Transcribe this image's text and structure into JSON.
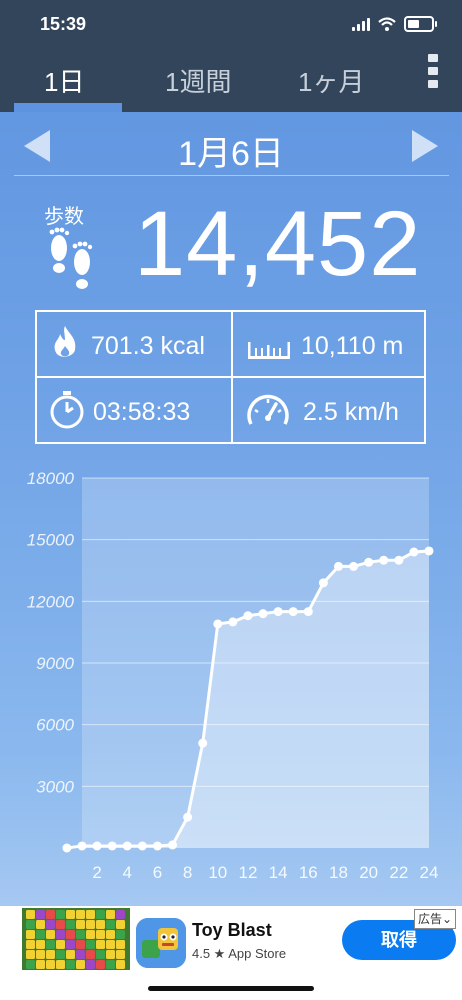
{
  "status": {
    "time": "15:39"
  },
  "tabs": [
    {
      "label": "1日"
    },
    {
      "label": "1週間"
    },
    {
      "label": "1ヶ月"
    }
  ],
  "date": "1月6日",
  "steps": {
    "label": "歩数",
    "value": "14,452"
  },
  "stats": {
    "calories": "701.3 kcal",
    "distance": "10,110 m",
    "time": "03:58:33",
    "speed": "2.5 km/h"
  },
  "chart_data": {
    "type": "line",
    "x": [
      0,
      1,
      2,
      3,
      4,
      5,
      6,
      7,
      8,
      9,
      10,
      11,
      12,
      13,
      14,
      15,
      16,
      17,
      18,
      19,
      20,
      21,
      22,
      23,
      24
    ],
    "values": [
      0,
      100,
      100,
      100,
      100,
      100,
      100,
      150,
      1500,
      5100,
      10900,
      11000,
      11300,
      11400,
      11500,
      11500,
      11500,
      12900,
      13700,
      13700,
      13900,
      14000,
      14000,
      14400,
      14450
    ],
    "xticks": [
      "2",
      "4",
      "6",
      "8",
      "10",
      "12",
      "14",
      "16",
      "18",
      "20",
      "22",
      "24"
    ],
    "xtick_values": [
      2,
      4,
      6,
      8,
      10,
      12,
      14,
      16,
      18,
      20,
      22,
      24
    ],
    "yticks": [
      "3000",
      "6000",
      "9000",
      "12000",
      "15000",
      "18000"
    ],
    "ytick_values": [
      3000,
      6000,
      9000,
      12000,
      15000,
      18000
    ],
    "ylim": [
      0,
      18000
    ],
    "xlim": [
      0,
      24
    ],
    "grid": true,
    "title": "",
    "xlabel": "",
    "ylabel": ""
  },
  "ad": {
    "title": "Toy Blast",
    "subtitle": "4.5 ★ App Store",
    "button": "取得",
    "badge": "広告"
  }
}
